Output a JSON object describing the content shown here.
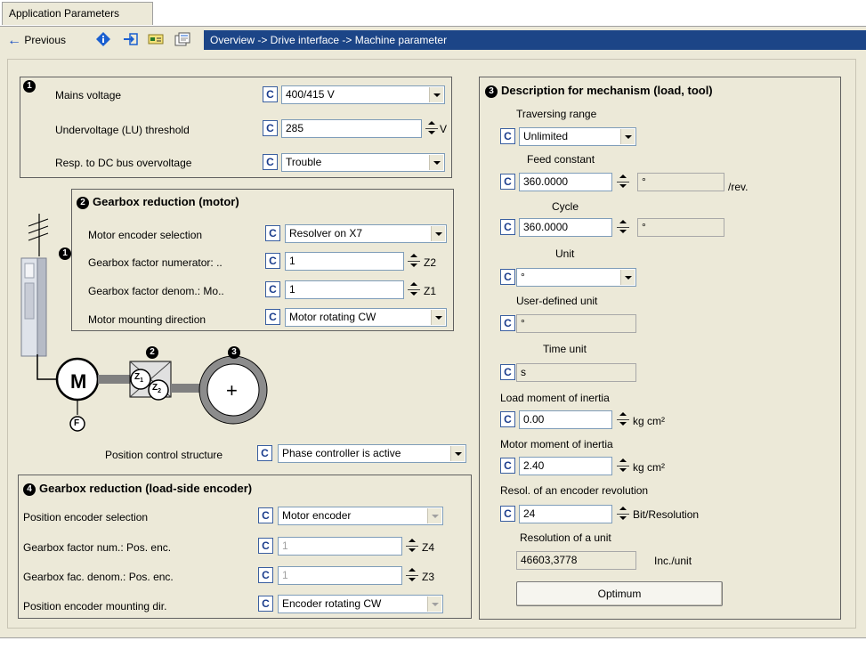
{
  "tab": {
    "label": "Application Parameters"
  },
  "toolbar": {
    "previous_label": "Previous",
    "breadcrumb": "Overview -> Drive interface -> Machine parameter",
    "icons": [
      "back-arrow-icon",
      "info-diamond-icon",
      "exit-icon",
      "card-icon",
      "properties-icon"
    ]
  },
  "c_label": "C",
  "group1": {
    "number": "1",
    "rows": [
      {
        "label": "Mains voltage",
        "value": "400/415 V",
        "type": "dropdown",
        "unit": ""
      },
      {
        "label": "Undervoltage (LU) threshold",
        "value": "285",
        "type": "spin",
        "unit": "V"
      },
      {
        "label": "Resp. to DC bus overvoltage",
        "value": "Trouble",
        "type": "dropdown",
        "unit": ""
      }
    ]
  },
  "group2": {
    "number": "2",
    "title": "Gearbox reduction (motor)",
    "rows": [
      {
        "label": "Motor encoder selection",
        "value": "Resolver on X7",
        "type": "dropdown",
        "unit": ""
      },
      {
        "label": "Gearbox factor numerator: ..",
        "value": "1",
        "type": "spin",
        "unit": "Z2"
      },
      {
        "label": "Gearbox factor denom.: Mo..",
        "value": "1",
        "type": "spin",
        "unit": "Z1"
      },
      {
        "label": "Motor mounting direction",
        "value": "Motor rotating CW",
        "type": "dropdown",
        "unit": ""
      }
    ]
  },
  "diagram": {
    "num1": "1",
    "num2": "2",
    "num3": "3",
    "motor": "M",
    "feedback": "F",
    "z1": "Z",
    "z1_sub": "1",
    "z2": "Z",
    "z2_sub": "2",
    "plus": "+"
  },
  "position_control": {
    "label": "Position control structure",
    "value": "Phase controller is active"
  },
  "group4": {
    "number": "4",
    "title": "Gearbox reduction (load-side encoder)",
    "rows": [
      {
        "label": "Position encoder selection",
        "value": "Motor encoder",
        "type": "dropdown",
        "unit": "",
        "disabled": true
      },
      {
        "label": "Gearbox factor num.: Pos. enc.",
        "value": "1",
        "type": "spin",
        "unit": "Z4",
        "disabled": true
      },
      {
        "label": "Gearbox fac. denom.: Pos. enc.",
        "value": "1",
        "type": "spin",
        "unit": "Z3",
        "disabled": true
      },
      {
        "label": "Position encoder mounting dir.",
        "value": "Encoder rotating CW",
        "type": "dropdown",
        "unit": "",
        "disabled": true
      }
    ]
  },
  "group3": {
    "number": "3",
    "title": "Description for mechanism (load, tool)",
    "traversing_range": {
      "label": "Traversing range",
      "value": "Unlimited"
    },
    "feed_constant": {
      "label": "Feed constant",
      "value": "360.0000",
      "unit_box": "°",
      "suffix": "/rev."
    },
    "cycle": {
      "label": "Cycle",
      "value": "360.0000",
      "unit_box": "°"
    },
    "unit": {
      "label": "Unit",
      "value": "°"
    },
    "user_unit": {
      "label": "User-defined unit",
      "value": "°"
    },
    "time_unit": {
      "label": "Time unit",
      "value": "s"
    },
    "load_inertia": {
      "label": "Load moment of inertia",
      "value": "0.00",
      "unit": "kg cm²"
    },
    "motor_inertia": {
      "label": "Motor moment of inertia",
      "value": "2.40",
      "unit": "kg cm²"
    },
    "resolution_enc": {
      "label": "Resol. of an encoder revolution",
      "value": "24",
      "unit": "Bit/Resolution"
    },
    "resolution_unit": {
      "label": "Resolution of a unit",
      "value": "46603,3778",
      "unit": "Inc./unit"
    },
    "optimum_label": "Optimum"
  },
  "colors": {
    "breadcrumb_bg": "#1c4587",
    "panel_bg": "#ece9d8",
    "c_button": "#1a3c8c"
  }
}
